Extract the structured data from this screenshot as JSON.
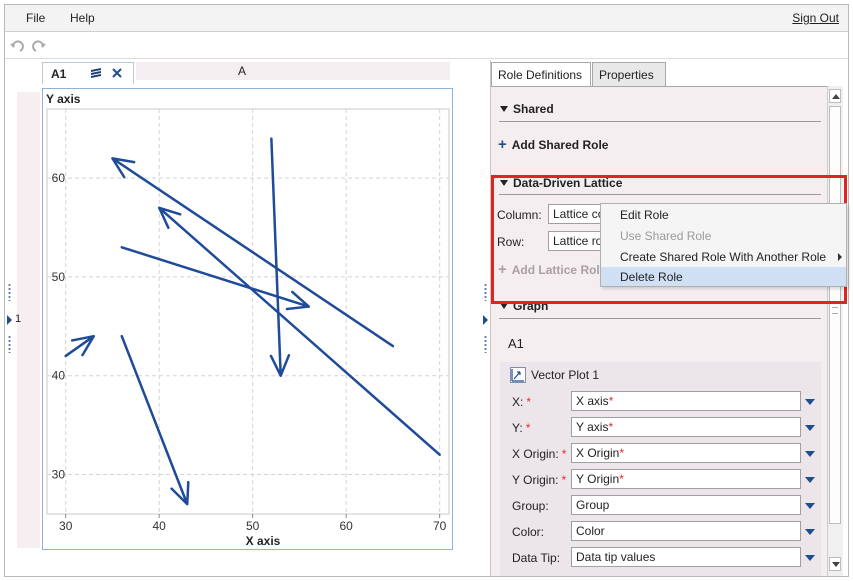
{
  "menubar": {
    "file": "File",
    "help": "Help",
    "sign_out": "Sign Out"
  },
  "toolbar": {
    "undo_icon": "undo-icon",
    "redo_icon": "redo-icon"
  },
  "left_strip": {
    "row_number": "1"
  },
  "cell_tab": {
    "label": "A1"
  },
  "column_header": {
    "label": "A"
  },
  "chart_data": {
    "type": "vector",
    "ylabel": "Y axis",
    "xlabel": "X axis",
    "xlim": [
      28,
      71
    ],
    "ylim": [
      26,
      67
    ],
    "xticks": [
      30,
      40,
      50,
      60,
      70
    ],
    "yticks": [
      30,
      40,
      50,
      60
    ],
    "grid": true,
    "color": "#1f4b99",
    "vectors": [
      {
        "x0": 65,
        "y0": 43,
        "x1": 35,
        "y1": 62
      },
      {
        "x0": 70,
        "y0": 32,
        "x1": 40,
        "y1": 57
      },
      {
        "x0": 36,
        "y0": 53,
        "x1": 56,
        "y1": 47
      },
      {
        "x0": 52,
        "y0": 64,
        "x1": 53,
        "y1": 40
      },
      {
        "x0": 36,
        "y0": 44,
        "x1": 43,
        "y1": 27
      },
      {
        "x0": 30,
        "y0": 42,
        "x1": 33,
        "y1": 44
      }
    ]
  },
  "right_panel": {
    "tabs": [
      {
        "label": "Role Definitions"
      },
      {
        "label": "Properties"
      }
    ],
    "shared": {
      "header": "Shared",
      "add": "Add Shared Role"
    },
    "lattice": {
      "header": "Data-Driven Lattice",
      "column_label": "Column:",
      "column_value": "Lattice column",
      "row_label": "Row:",
      "row_value": "Lattice row",
      "add": "Add Lattice Role"
    },
    "graph": {
      "header": "Graph",
      "cell": "A1",
      "plot_title": "Vector Plot 1",
      "plot_icon": "vector-plot-icon",
      "roles": [
        {
          "label": "X:",
          "required": true,
          "value": "X axis",
          "value_required": true
        },
        {
          "label": "Y:",
          "required": true,
          "value": "Y axis",
          "value_required": true
        },
        {
          "label": "X Origin:",
          "required": true,
          "value": "X Origin",
          "value_required": true
        },
        {
          "label": "Y Origin:",
          "required": true,
          "value": "Y Origin",
          "value_required": true
        },
        {
          "label": "Group:",
          "required": false,
          "value": "Group",
          "value_required": false
        },
        {
          "label": "Color:",
          "required": false,
          "value": "Color",
          "value_required": false
        },
        {
          "label": "Data Tip:",
          "required": false,
          "value": "Data tip values",
          "value_required": false
        }
      ]
    },
    "required_mark": "*"
  },
  "context_menu": {
    "items": [
      {
        "label": "Edit Role",
        "enabled": true
      },
      {
        "label": "Use Shared Role",
        "enabled": false
      },
      {
        "label": "Create Shared Role With Another Role",
        "enabled": true,
        "submenu": true
      },
      {
        "label": "Delete Role",
        "enabled": true,
        "highlighted": true
      }
    ]
  },
  "colors": {
    "highlight_box": "#e02424",
    "vector": "#1f4b99",
    "menu_hover": "#cfe0f5"
  }
}
